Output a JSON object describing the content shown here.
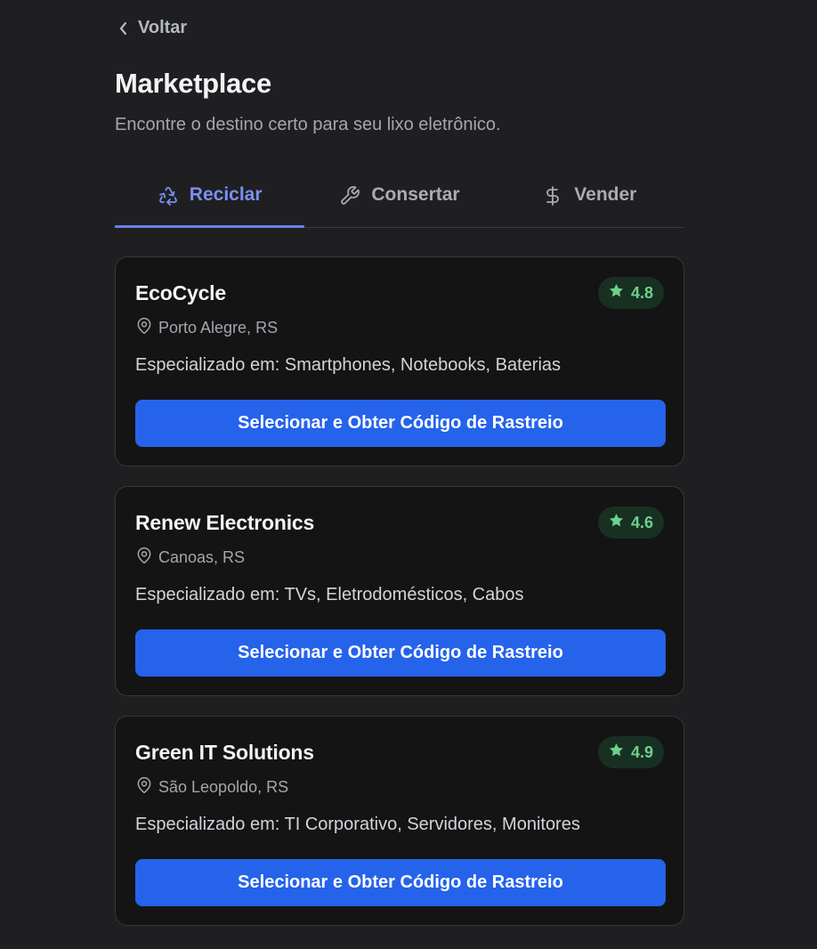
{
  "back_label": "Voltar",
  "title": "Marketplace",
  "subtitle": "Encontre o destino certo para seu lixo eletrônico.",
  "tabs": [
    {
      "label": "Reciclar",
      "icon": "recycle-icon",
      "active": true
    },
    {
      "label": "Consertar",
      "icon": "wrench-icon",
      "active": false
    },
    {
      "label": "Vender",
      "icon": "dollar-icon",
      "active": false
    }
  ],
  "colors": {
    "accent": "#7c8ff2",
    "button": "#2563eb",
    "rating_text": "#6fcf8c",
    "rating_bg": "#183022"
  },
  "cards": [
    {
      "name": "EcoCycle",
      "rating": "4.8",
      "location": "Porto Alegre, RS",
      "specialty": "Especializado em: Smartphones, Notebooks, Baterias",
      "button_label": "Selecionar e Obter Código de Rastreio"
    },
    {
      "name": "Renew Electronics",
      "rating": "4.6",
      "location": "Canoas, RS",
      "specialty": "Especializado em: TVs, Eletrodomésticos, Cabos",
      "button_label": "Selecionar e Obter Código de Rastreio"
    },
    {
      "name": "Green IT Solutions",
      "rating": "4.9",
      "location": "São Leopoldo, RS",
      "specialty": "Especializado em: TI Corporativo, Servidores, Monitores",
      "button_label": "Selecionar e Obter Código de Rastreio"
    }
  ]
}
